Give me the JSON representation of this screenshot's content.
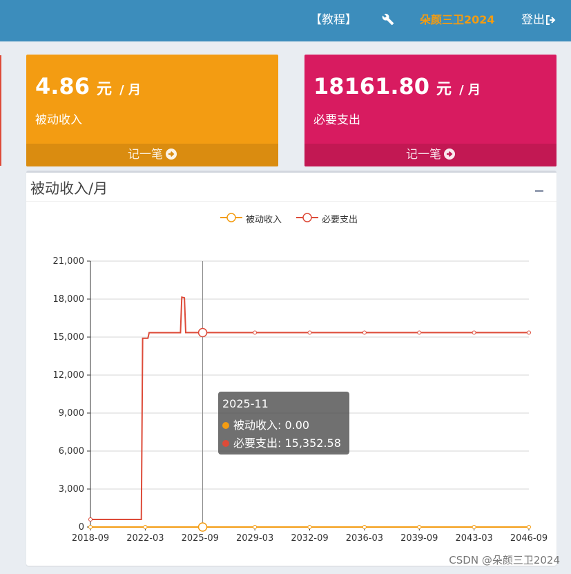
{
  "topbar": {
    "tutorial": "【教程】",
    "user": "朵颜三卫2024",
    "logout": "登出"
  },
  "income_box": {
    "value": "4.86",
    "unit": "元",
    "per": "/ 月",
    "caption": "被动收入",
    "footer": "记一笔"
  },
  "expense_box": {
    "value": "18161.80",
    "unit": "元",
    "per": "/ 月",
    "caption": "必要支出",
    "footer": "记一笔"
  },
  "panel": {
    "title": "被动收入/月"
  },
  "tooltip": {
    "date": "2025-11",
    "rows": [
      {
        "label": "被动收入: 0.00",
        "color": "#f39c12"
      },
      {
        "label": "必要支出: 15,352.58",
        "color": "#dd4b39"
      }
    ]
  },
  "watermark": "CSDN @朵颜三卫2024",
  "chart_data": {
    "type": "line",
    "x_ticks": [
      "2018-09",
      "2022-03",
      "2025-09",
      "2029-03",
      "2032-09",
      "2036-03",
      "2039-09",
      "2043-03",
      "2046-09"
    ],
    "y_ticks": [
      "0",
      "3,000",
      "6,000",
      "9,000",
      "12,000",
      "15,000",
      "18,000",
      "21,000"
    ],
    "ylim": [
      0,
      21000
    ],
    "grid": true,
    "legend_position": "top-center",
    "series": [
      {
        "name": "被动收入",
        "color": "#f39c12",
        "x": [
          "2018-09",
          "2046-09"
        ],
        "y": [
          0,
          0
        ]
      },
      {
        "name": "必要支出",
        "color": "#dd4b39",
        "x": [
          "2018-09",
          "2021-12",
          "2022-01",
          "2022-05",
          "2022-06",
          "2022-07",
          "2024-06",
          "2024-07",
          "2024-09",
          "2024-10",
          "2025-11",
          "2046-09"
        ],
        "y": [
          600,
          600,
          14900,
          14900,
          15350,
          15350,
          15350,
          18150,
          18100,
          15352.58,
          15352.58,
          15352.58
        ]
      }
    ],
    "highlight": {
      "x": "2025-11",
      "values": [
        0,
        15352.58
      ]
    }
  }
}
